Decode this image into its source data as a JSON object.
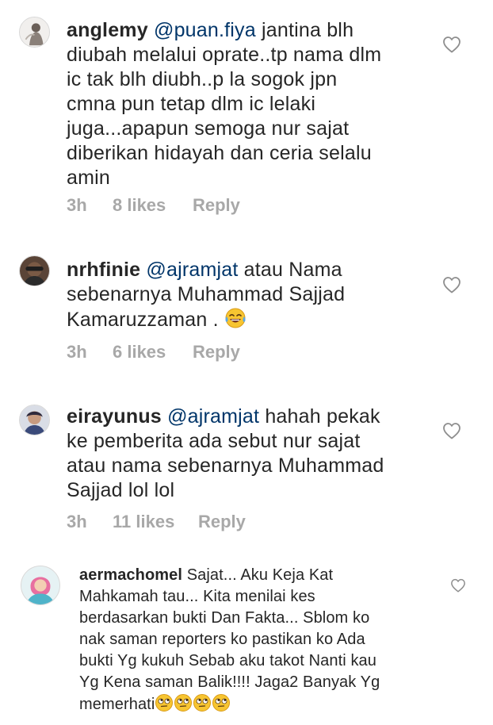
{
  "comments": [
    {
      "username": "anglemy",
      "mention": "@puan.fiya",
      "text": " jantina blh\ndiubah melalui oprate..tp nama dlm\nic tak blh diubh..p la sogok jpn\ncmna pun tetap dlm ic lelaki\njuga...apapun semoga nur sajat\ndiberikan hidayah dan ceria selalu\namin",
      "time": "3h",
      "likes": "8 likes",
      "reply": "Reply"
    },
    {
      "username": "nrhfinie",
      "mention": "@ajramjat",
      "text": " atau Nama\nsebenarnya Muhammad Sajjad\nKamaruzzaman . ",
      "emoji": "face-with-tears-of-joy",
      "time": "3h",
      "likes": "6 likes",
      "reply": "Reply"
    },
    {
      "username": "eirayunus",
      "mention": "@ajramjat",
      "text": " hahah pekak\nke pemberita ada  sebut nur sajat\natau nama sebenarnya Muhammad\nSajjad lol lol",
      "time": "3h",
      "likes": "11 likes",
      "reply": "Reply"
    },
    {
      "username": "aermachomel",
      "text": " Sajat... Aku Keja Kat\nMahkamah tau... Kita menilai kes\nberdasarkan bukti Dan Fakta... Sblom ko\nnak saman reporters ko pastikan ko Ada\nbukti Yg kukuh Sebab aku takot Nanti kau\nYg Kena saman Balik!!!! Jaga2 Banyak Yg\nmemerhati",
      "emoji": "face-with-rolling-eyes",
      "emoji_count": 4
    }
  ],
  "icons": {
    "like": "heart-outline-icon"
  },
  "colors": {
    "text": "#262626",
    "muted": "#a8a8a8",
    "mention": "#003569",
    "heart": "#8e8e8e"
  }
}
